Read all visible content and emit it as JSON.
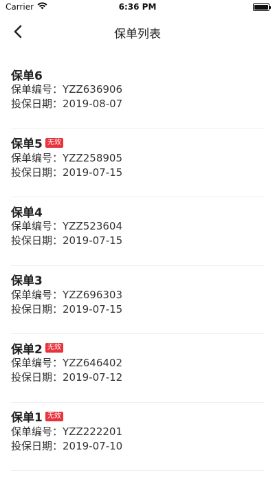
{
  "status_bar": {
    "carrier": "Carrier",
    "time": "6:36 PM"
  },
  "nav": {
    "title": "保单列表",
    "back_icon": "chevron-left-icon"
  },
  "labels": {
    "policy_number_label": "保单编号：",
    "insure_date_label": "投保日期："
  },
  "policies": [
    {
      "name": "保单6",
      "invalid": false,
      "badge": "",
      "number": "YZZ636906",
      "date": "2019-08-07"
    },
    {
      "name": "保单5",
      "invalid": true,
      "badge": "无效",
      "number": "YZZ258905",
      "date": "2019-07-15"
    },
    {
      "name": "保单4",
      "invalid": false,
      "badge": "",
      "number": "YZZ523604",
      "date": "2019-07-15"
    },
    {
      "name": "保单3",
      "invalid": false,
      "badge": "",
      "number": "YZZ696303",
      "date": "2019-07-15"
    },
    {
      "name": "保单2",
      "invalid": true,
      "badge": "无效",
      "number": "YZZ646402",
      "date": "2019-07-12"
    },
    {
      "name": "保单1",
      "invalid": true,
      "badge": "无效",
      "number": "YZZ222201",
      "date": "2019-07-10"
    }
  ],
  "colors": {
    "badge_bg": "#e8333c",
    "divider": "#eeeeee",
    "text": "#333333"
  }
}
